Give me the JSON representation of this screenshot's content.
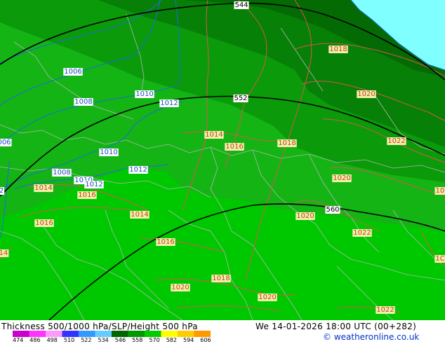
{
  "colors": {
    "land_light": "#00c800",
    "band_1": "#14b414",
    "band_2": "#0a9a0a",
    "band_3": "#068006",
    "band_4": "#046a04",
    "sea": "#7fffff",
    "slp_contour": "#d4594a",
    "height_contour": "#000000",
    "blue_contour": "#1a6fd6",
    "borders": "#b4b4b4"
  },
  "slp_labels": {
    "items": [
      {
        "text": "1018"
      },
      {
        "text": "1020"
      },
      {
        "text": "1022"
      },
      {
        "text": "1014"
      },
      {
        "text": "1016"
      },
      {
        "text": "1018"
      },
      {
        "text": "1020"
      },
      {
        "text": "1020"
      },
      {
        "text": "1022"
      },
      {
        "text": "1014"
      },
      {
        "text": "1016"
      },
      {
        "text": "1016"
      },
      {
        "text": "1014"
      },
      {
        "text": "1016"
      },
      {
        "text": "14"
      },
      {
        "text": "1018"
      },
      {
        "text": "1020"
      },
      {
        "text": "1020"
      },
      {
        "text": "1022"
      },
      {
        "text": "102"
      },
      {
        "text": "1C"
      }
    ]
  },
  "blue_labels": {
    "items": [
      {
        "text": "1006"
      },
      {
        "text": "1008"
      },
      {
        "text": "1010"
      },
      {
        "text": "1012"
      },
      {
        "text": "006"
      },
      {
        "text": "1010"
      },
      {
        "text": "1012"
      },
      {
        "text": "1008"
      },
      {
        "text": "1010"
      },
      {
        "text": "1012"
      },
      {
        "text": "2"
      }
    ]
  },
  "height_labels": {
    "items": [
      {
        "text": "544"
      },
      {
        "text": "552"
      },
      {
        "text": "560"
      }
    ]
  },
  "footer": {
    "title": "Thickness 500/1000 hPa/SLP/Height 500 hPa",
    "datetime": "We 14-01-2026 18:00 UTC (00+282)",
    "copyright": "© weatheronline.co.uk",
    "scale_ticks": [
      "474",
      "486",
      "498",
      "510",
      "522",
      "534",
      "546",
      "558",
      "570",
      "582",
      "594",
      "606"
    ],
    "scale_colors": [
      "#cc00cc",
      "#ff33ff",
      "#ff99ff",
      "#3333ff",
      "#3399ff",
      "#66ccff",
      "#006600",
      "#009900",
      "#00cc00",
      "#ffff00",
      "#ffcc00",
      "#ff9900"
    ]
  }
}
